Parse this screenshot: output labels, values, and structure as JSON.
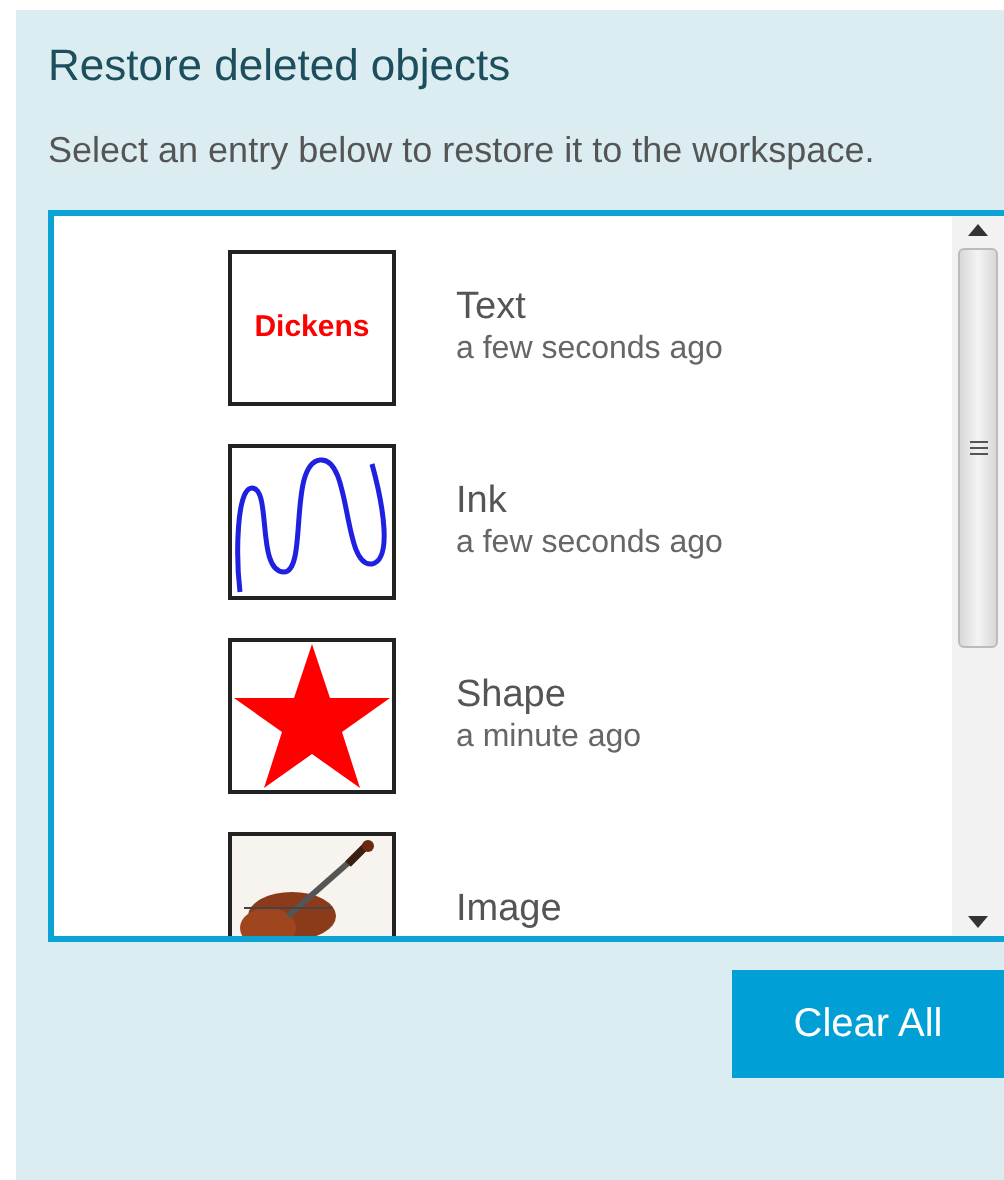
{
  "panel": {
    "title": "Restore deleted objects",
    "description": "Select an entry below to restore it to the workspace."
  },
  "entries": [
    {
      "kind": "text",
      "thumbnail_text": "Dickens",
      "name": "Text",
      "time": "a few seconds ago"
    },
    {
      "kind": "ink",
      "name": "Ink",
      "time": "a few seconds ago"
    },
    {
      "kind": "shape",
      "name": "Shape",
      "time": "a minute ago"
    },
    {
      "name": "Image"
    }
  ],
  "buttons": [
    "Clear All"
  ]
}
